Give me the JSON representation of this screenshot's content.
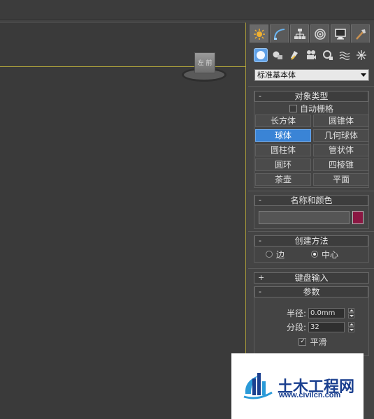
{
  "viewport": {
    "viewcube_face_label": "左 前"
  },
  "command_panel": {
    "tabs": [
      {
        "icon": "create-icon",
        "active": true
      },
      {
        "icon": "modify-icon",
        "active": false
      },
      {
        "icon": "hierarchy-icon",
        "active": false
      },
      {
        "icon": "motion-icon",
        "active": false
      },
      {
        "icon": "display-icon",
        "active": false
      },
      {
        "icon": "utilities-icon",
        "active": false
      }
    ],
    "categories": [
      {
        "icon": "geometry-icon",
        "active": true
      },
      {
        "icon": "shapes-icon",
        "active": false
      },
      {
        "icon": "lights-icon",
        "active": false
      },
      {
        "icon": "cameras-icon",
        "active": false
      },
      {
        "icon": "helpers-icon",
        "active": false
      },
      {
        "icon": "space-warps-icon",
        "active": false
      },
      {
        "icon": "systems-icon",
        "active": false
      }
    ],
    "primitive_dropdown": "标准基本体",
    "object_type": {
      "sign": "-",
      "title": "对象类型",
      "autogrid_label": "自动栅格",
      "buttons": [
        "长方体",
        "圆锥体",
        "球体",
        "几何球体",
        "圆柱体",
        "管状体",
        "圆环",
        "四棱锥",
        "茶壶",
        "平面"
      ],
      "active_button": "球体"
    },
    "name_and_color": {
      "sign": "-",
      "title": "名称和颜色",
      "name_value": "",
      "color": "#8a1742"
    },
    "creation_method": {
      "sign": "-",
      "title": "创建方法",
      "option_edge": "边",
      "option_center": "中心",
      "selected": "中心"
    },
    "keyboard_entry": {
      "sign": "+",
      "title": "键盘输入"
    },
    "parameters": {
      "sign": "-",
      "title": "参数",
      "radius_label": "半径:",
      "radius_value": "0.0mm",
      "segments_label": "分段:",
      "segments_value": "32",
      "smooth_label": "平滑",
      "smooth_checked": true
    }
  },
  "watermark": {
    "name": "土木工程网",
    "url": "www.civilcn.com"
  },
  "colors": {
    "active_blue": "#3a84d6",
    "viewport_border": "#b7a93c",
    "object_color": "#8a1742"
  }
}
